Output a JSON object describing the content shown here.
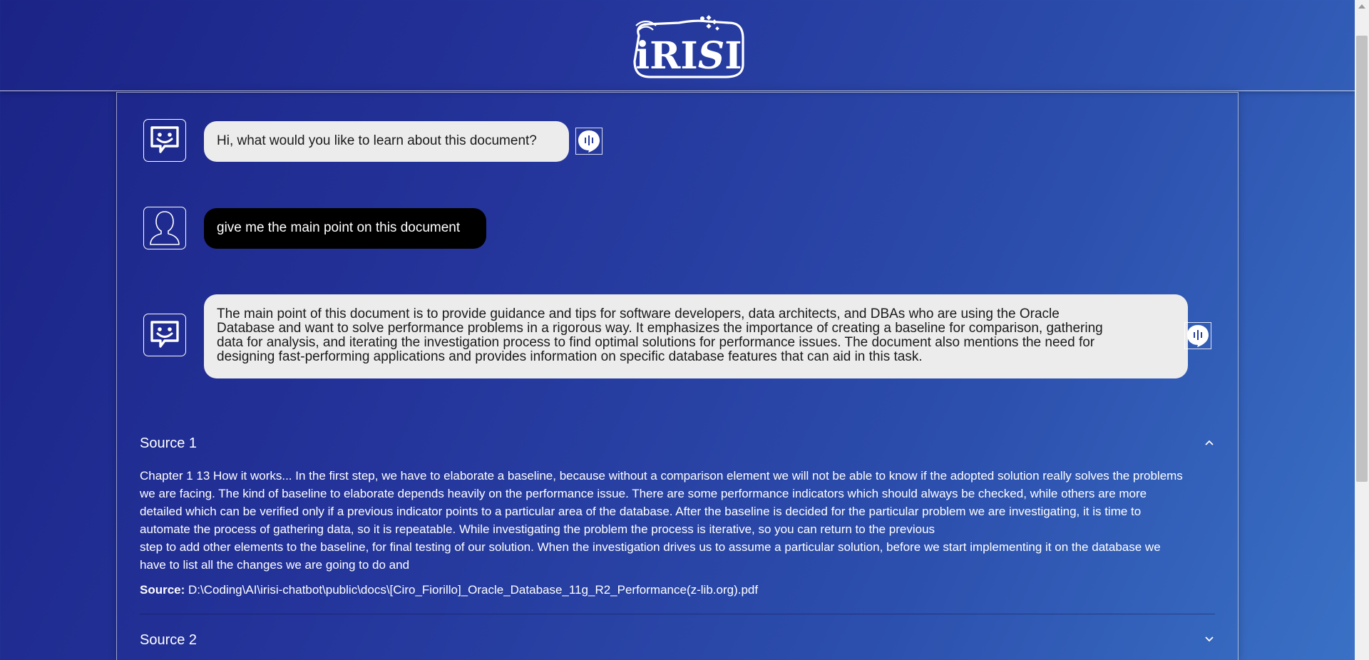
{
  "brand": {
    "logo_text": "iRISI"
  },
  "messages": [
    {
      "role": "bot",
      "text": "Hi, what would you like to learn about this document?"
    },
    {
      "role": "user",
      "text": "give me the main point on this document"
    },
    {
      "role": "bot",
      "lines": [
        "The main point of this document is to provide guidance and tips for software developers, data architects, and DBAs who are using the Oracle",
        "Database and want to solve performance problems in a rigorous way. It emphasizes the importance of creating a baseline for comparison, gathering",
        "data for analysis, and iterating the investigation process to find optimal solutions for performance issues. The document also mentions the need for",
        "designing fast-performing applications and provides information on specific database features that can aid in this task."
      ]
    }
  ],
  "sources": [
    {
      "title": "Source 1",
      "expanded": true,
      "lines": [
        "Chapter 1 13 How it works... In the first step, we have to elaborate a baseline, because without a comparison element we will not be able to know if the adopted solution really solves the problems",
        "we are facing. The kind of baseline to elaborate depends heavily on the performance issue. There are some performance indicators which should always be checked, while others are more",
        "detailed which can be verified only if a previous indicator points to a particular area of the database. After the baseline is decided for the particular problem we are investigating, it is time to",
        "automate the process of gathering data, so it is repeatable. While investigating the problem the process is iterative, so you can return to the previous",
        "step to add other elements to the baseline, for final testing of our solution. When the investigation drives us to assume a particular solution, before we start implementing it on the database we",
        "have to list all the changes we are going to do and"
      ],
      "path_label": "Source:",
      "path": "D:\\Coding\\AI\\irisi-chatbot\\public\\docs\\[Ciro_Fiorillo]_Oracle_Database_11g_R2_Performance(z-lib.org).pdf"
    },
    {
      "title": "Source 2",
      "expanded": false
    }
  ],
  "icons": {
    "bot_avatar": "chat-bot-icon",
    "user_avatar": "user-icon",
    "audio": "audio-wave-icon",
    "expanded": "chevron-up-icon",
    "collapsed": "chevron-down-icon"
  },
  "colors": {
    "bot_bubble": "#ececec",
    "user_bubble": "#000000",
    "background_start": "#1b2386",
    "background_end": "#3a72c6"
  }
}
